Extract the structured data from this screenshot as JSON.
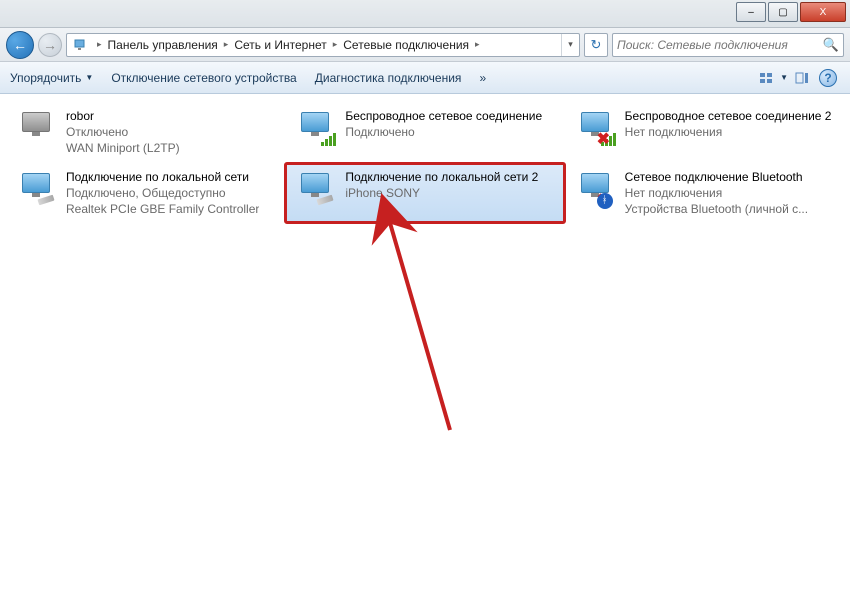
{
  "titlebar": {
    "minimize": "–",
    "maximize": "▢",
    "close": "X"
  },
  "breadcrumb": {
    "items": [
      "Панель управления",
      "Сеть и Интернет",
      "Сетевые подключения"
    ],
    "separator": "▸",
    "dropdown": "▾",
    "refresh": "↻"
  },
  "search": {
    "placeholder": "Поиск: Сетевые подключения",
    "icon": "🔍"
  },
  "commands": {
    "organize": "Упорядочить",
    "disable": "Отключение сетевого устройства",
    "diagnose": "Диагностика подключения",
    "more": "»",
    "help": "?"
  },
  "connections": [
    {
      "title": "robor",
      "status": "Отключено",
      "device": "WAN Miniport (L2TP)",
      "icon_type": "dialup",
      "selected": false,
      "error": false
    },
    {
      "title": "Беспроводное сетевое соединение",
      "status": "Подключено",
      "device": "",
      "icon_type": "wireless",
      "selected": false,
      "error": false
    },
    {
      "title": "Беспроводное сетевое соединение 2",
      "status": "Нет подключения",
      "device": "",
      "icon_type": "wireless",
      "selected": false,
      "error": true
    },
    {
      "title": "Подключение по локальной сети",
      "status": "Подключено, Общедоступно",
      "device": "Realtek PCIe GBE Family Controller",
      "icon_type": "lan",
      "selected": false,
      "error": false
    },
    {
      "title": "Подключение по локальной сети 2",
      "status": "",
      "device": "iPhone SONY",
      "icon_type": "lan",
      "selected": true,
      "error": false
    },
    {
      "title": "Сетевое подключение Bluetooth",
      "status": "Нет подключения",
      "device": "Устройства Bluetooth (личной с...",
      "icon_type": "bluetooth",
      "selected": false,
      "error": true
    }
  ]
}
